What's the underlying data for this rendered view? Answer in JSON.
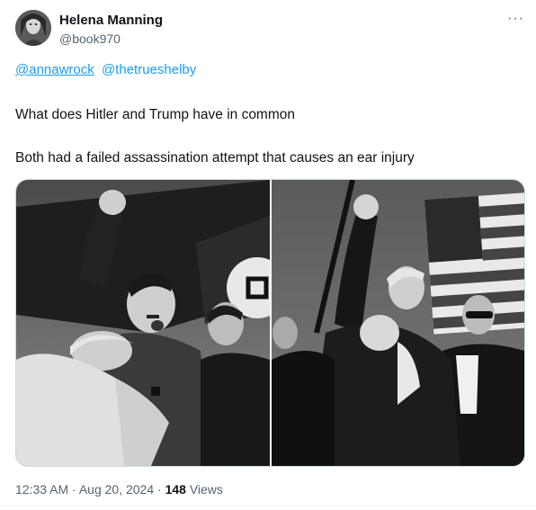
{
  "author": {
    "name": "Helena Manning",
    "handle": "@book970"
  },
  "mentions": [
    "@annawrock",
    "@thetrueshelby"
  ],
  "tweet": {
    "line1": "What does Hitler and Trump have in common",
    "line2": "Both had a failed assassination attempt that causes an ear injury"
  },
  "media": {
    "left_alt": "Black-and-white photo of Hitler with raised fist",
    "right_alt": "Black-and-white photo of Trump with raised fist and American flag"
  },
  "meta": {
    "time": "12:33 AM",
    "sep1": " · ",
    "date": "Aug 20, 2024",
    "sep2": " · ",
    "views_count": "148",
    "views_label": " Views"
  },
  "more_icon": "···",
  "colors": {
    "link": "#1d9bf0",
    "secondary": "#536471",
    "text": "#0f1419"
  }
}
